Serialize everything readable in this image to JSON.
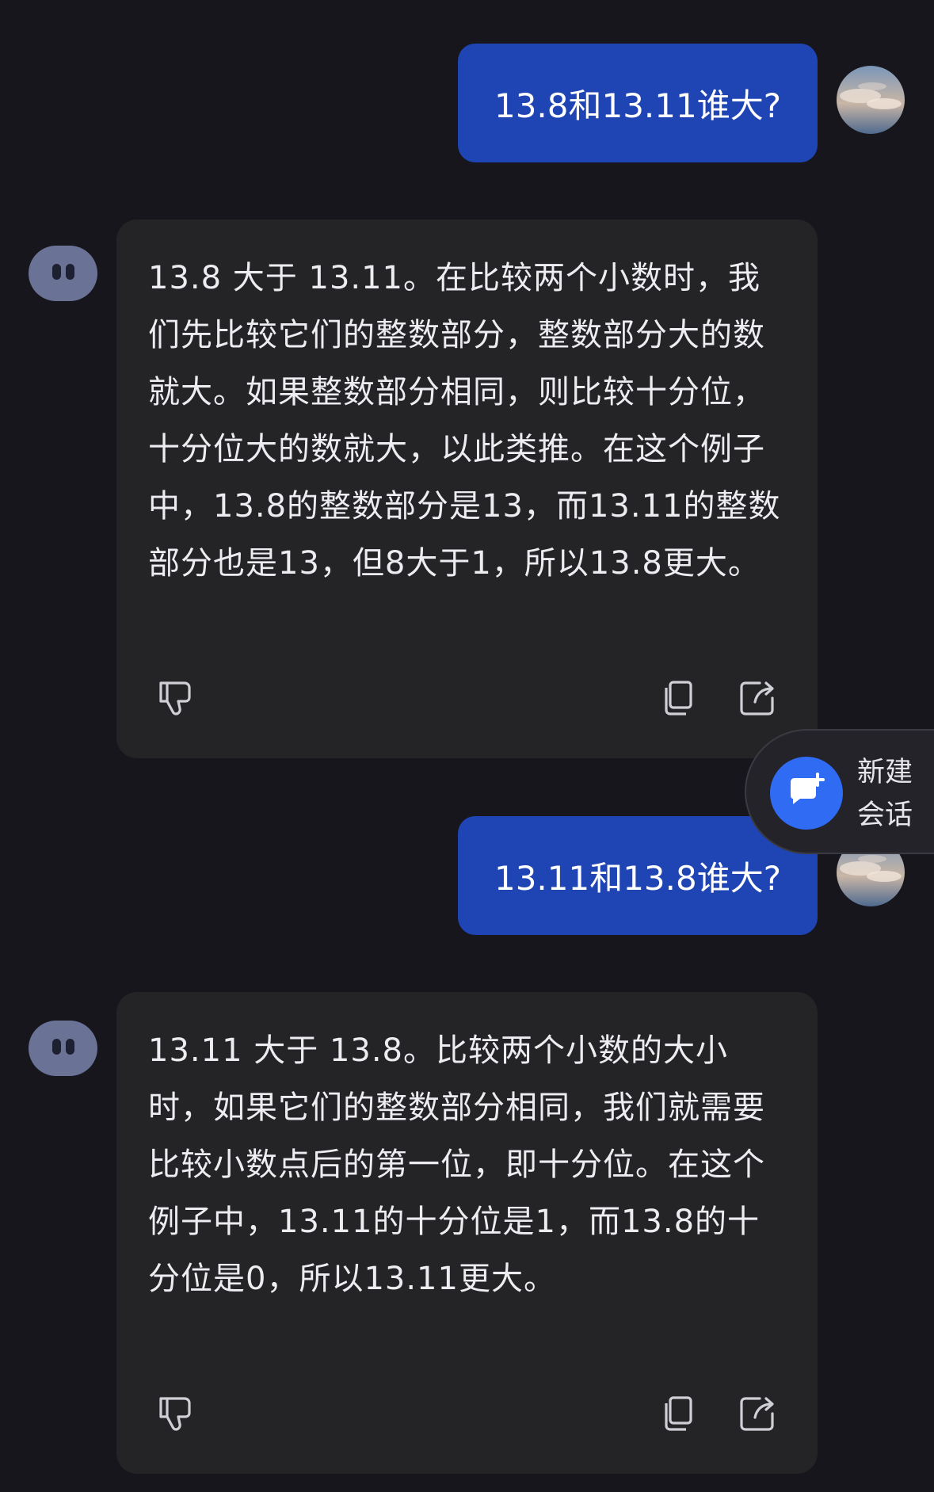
{
  "conversation": {
    "messages": [
      {
        "role": "user",
        "text": "13.8和13.11谁大?"
      },
      {
        "role": "assistant",
        "text": "13.8 大于 13.11。在比较两个小数时，我们先比较它们的整数部分，整数部分大的数就大。如果整数部分相同，则比较十分位，十分位大的数就大，以此类推。在这个例子中，13.8的整数部分是13，而13.11的整数部分也是13，但8大于1，所以13.8更大。"
      },
      {
        "role": "user",
        "text": "13.11和13.8谁大?"
      },
      {
        "role": "assistant",
        "text": "13.11 大于 13.8。比较两个小数的大小时，如果它们的整数部分相同，我们就需要比较小数点后的第一位，即十分位。在这个例子中，13.11的十分位是1，而13.8的十分位是0，所以13.11更大。"
      }
    ]
  },
  "message_actions": {
    "icons": [
      "thumbs-down-icon",
      "copy-icon",
      "share-icon"
    ]
  },
  "new_chat": {
    "label": "新建\n会话",
    "icon": "chat-plus-icon"
  },
  "colors": {
    "background": "#16161c",
    "user_bubble": "#1f44b3",
    "assistant_bubble": "#242427",
    "accent": "#2f6bf3"
  }
}
